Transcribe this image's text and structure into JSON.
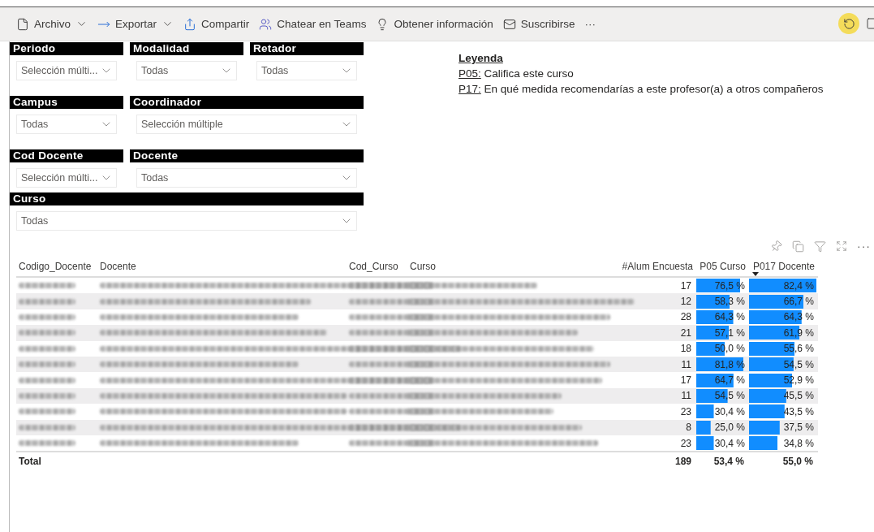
{
  "toolbar": {
    "items": [
      {
        "kind": "file",
        "label": "Archivo",
        "dropdown": true
      },
      {
        "kind": "export",
        "label": "Exportar",
        "dropdown": true
      },
      {
        "kind": "share",
        "label": "Compartir",
        "dropdown": false
      },
      {
        "kind": "teams",
        "label": "Chatear en Teams",
        "dropdown": false
      },
      {
        "kind": "insight",
        "label": "Obtener información",
        "dropdown": false
      },
      {
        "kind": "mail",
        "label": "Suscribirse",
        "dropdown": false
      }
    ],
    "more": "···"
  },
  "slicer_rows": [
    [
      {
        "title": "Periodo",
        "value": "Selección múlti..."
      },
      {
        "title": "Modalidad",
        "value": "Todas"
      },
      {
        "title": "Retador",
        "value": "Todas"
      }
    ],
    [
      {
        "title": "Campus",
        "value": "Todas"
      },
      {
        "title": "Coordinador",
        "value": "Selección múltiple"
      }
    ],
    [
      {
        "title": "Cod Docente",
        "value": "Selección múlti..."
      },
      {
        "title": "Docente",
        "value": "Todas"
      }
    ],
    [
      {
        "title": "Curso",
        "value": "Todas"
      }
    ]
  ],
  "legend": {
    "title": "Leyenda",
    "entries": [
      {
        "code": "P05:",
        "text": "Califica este curso"
      },
      {
        "code": "P17:",
        "text": "En qué medida recomendarías a este profesor(a) a otros compañeros"
      }
    ]
  },
  "visual_menu": {
    "more": "···"
  },
  "table": {
    "columns": [
      {
        "label": "Codigo_Docente",
        "sorted": false
      },
      {
        "label": "Docente",
        "sorted": false
      },
      {
        "label": "Cod_Curso",
        "sorted": false
      },
      {
        "label": "Curso",
        "sorted": false
      },
      {
        "label": "#Alum Encuesta",
        "sorted": false
      },
      {
        "label": "P05 Curso",
        "sorted": false
      },
      {
        "label": "P017 Docente",
        "sorted": true
      }
    ],
    "rows": [
      {
        "count": "17",
        "p05": "76,5 %",
        "p017": "82,4 %"
      },
      {
        "count": "12",
        "p05": "58,3 %",
        "p017": "66,7 %"
      },
      {
        "count": "28",
        "p05": "64,3 %",
        "p017": "64,3 %"
      },
      {
        "count": "21",
        "p05": "57,1 %",
        "p017": "61,9 %"
      },
      {
        "count": "18",
        "p05": "50,0 %",
        "p017": "55,6 %"
      },
      {
        "count": "11",
        "p05": "81,8 %",
        "p017": "54,5 %"
      },
      {
        "count": "17",
        "p05": "64,7 %",
        "p017": "52,9 %"
      },
      {
        "count": "11",
        "p05": "54,5 %",
        "p017": "45,5 %"
      },
      {
        "count": "23",
        "p05": "30,4 %",
        "p017": "43,5 %"
      },
      {
        "count": "8",
        "p05": "25,0 %",
        "p017": "37,5 %"
      },
      {
        "count": "23",
        "p05": "30,4 %",
        "p017": "34,8 %"
      }
    ],
    "total": {
      "label": "Total",
      "count": "189",
      "p05": "53,4 %",
      "p017": "55,0 %"
    }
  }
}
